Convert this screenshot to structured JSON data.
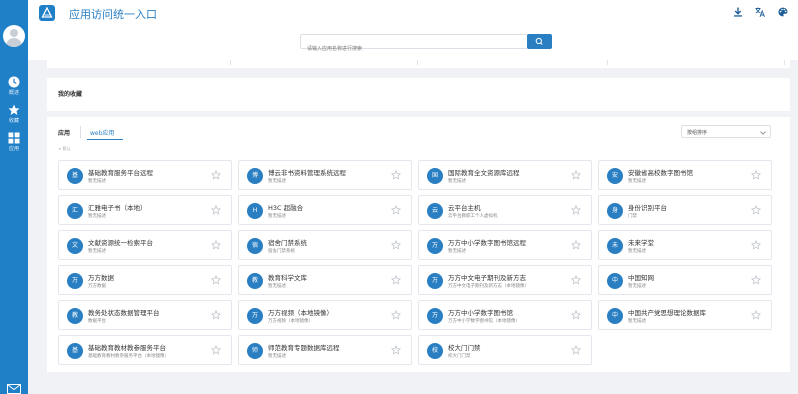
{
  "header": {
    "title": "应用访问统一入口",
    "search_placeholder": "请输入应用名称进行搜索",
    "icons": [
      "download-icon",
      "translate-icon",
      "palette-icon"
    ]
  },
  "sidebar": {
    "items": [
      {
        "label": "概述",
        "icon": "clock-icon"
      },
      {
        "label": "收藏",
        "icon": "star-icon"
      },
      {
        "label": "应用",
        "icon": "grid-icon"
      }
    ]
  },
  "favorites": {
    "title": "我的收藏"
  },
  "apps": {
    "tab_app": "应用",
    "tab_web": "web应用",
    "sort_label": "按组排序",
    "default_label": "默认",
    "cards": [
      {
        "badge": "基",
        "name": "基础教育服务平台远程",
        "desc": "暂无描述"
      },
      {
        "badge": "博",
        "name": "博云非书资料管理系统远程",
        "desc": "暂无描述"
      },
      {
        "badge": "国",
        "name": "国际教育全文资源库远程",
        "desc": "暂无描述"
      },
      {
        "badge": "安",
        "name": "安徽省高校数字图书馆",
        "desc": "暂无描述"
      },
      {
        "badge": "汇",
        "name": "汇雅电子书（本地）",
        "desc": "暂无描述"
      },
      {
        "badge": "H",
        "name": "H3C 超融合",
        "desc": "暂无描述"
      },
      {
        "badge": "云",
        "name": "云平台主机",
        "desc": "云平台教职工个人虚拟机"
      },
      {
        "badge": "身",
        "name": "身份识别平台",
        "desc": "门禁"
      },
      {
        "badge": "文",
        "name": "文献资源统一检索平台",
        "desc": "暂无描述"
      },
      {
        "badge": "宿",
        "name": "宿舍门禁系统",
        "desc": "宿舍门禁系统"
      },
      {
        "badge": "万",
        "name": "万方中小学数字图书馆远程",
        "desc": "暂无描述"
      },
      {
        "badge": "未",
        "name": "未来学堂",
        "desc": "暂无描述"
      },
      {
        "badge": "万",
        "name": "万方数据",
        "desc": "万方数据"
      },
      {
        "badge": "教",
        "name": "教育科学文库",
        "desc": "暂无描述"
      },
      {
        "badge": "万",
        "name": "万方中文电子期刊及新方志",
        "desc": "万方中文电子期刊及新方志（本地镜像）"
      },
      {
        "badge": "中",
        "name": "中国知网",
        "desc": "暂无描述"
      },
      {
        "badge": "教",
        "name": "教务处状态数据管理平台",
        "desc": "数据平台"
      },
      {
        "badge": "万",
        "name": "万方视频（本地镜像）",
        "desc": "万方视频（本地镜像）"
      },
      {
        "badge": "万",
        "name": "万方中小学数字图书馆",
        "desc": "万方中小学数字图书馆（本地镜像）"
      },
      {
        "badge": "中",
        "name": "中国共产党思想理论数据库",
        "desc": "暂无描述"
      },
      {
        "badge": "基",
        "name": "基础教育教材教参服务平台",
        "desc": "基础教育教材教参服务平台（本地镜像）"
      },
      {
        "badge": "师",
        "name": "师范教育专题数据库远程",
        "desc": "暂无描述"
      },
      {
        "badge": "校",
        "name": "校大门门禁",
        "desc": "校大门门禁"
      }
    ]
  },
  "colors": {
    "primary": "#2a7fc3",
    "sidebar": "#1f7fc7",
    "background": "#f0f2f5"
  }
}
